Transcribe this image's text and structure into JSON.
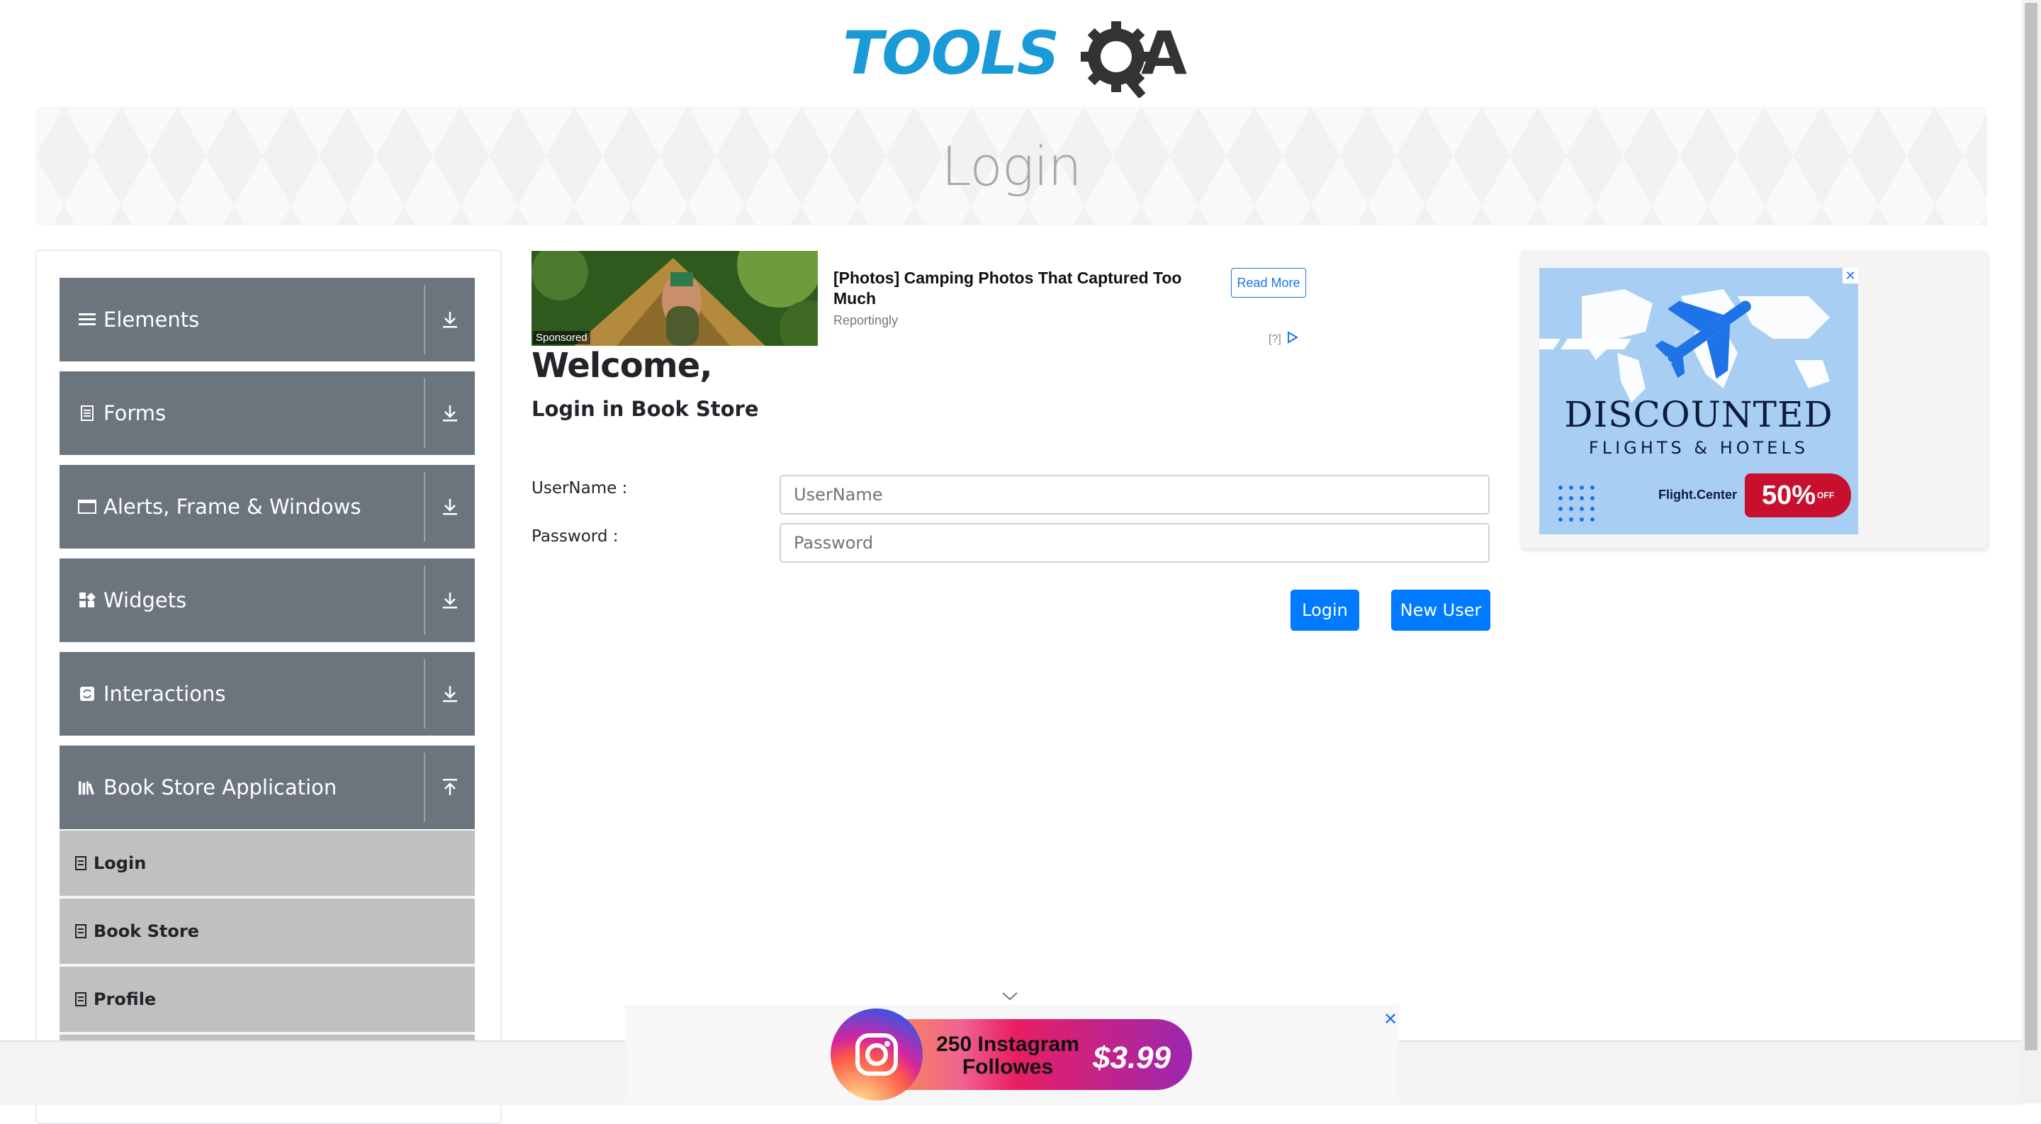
{
  "header": {
    "logo_text": "TOOLSQA"
  },
  "banner": {
    "title": "Login"
  },
  "sidebar": {
    "groups": [
      {
        "label": "Elements",
        "icon": "list-icon"
      },
      {
        "label": "Forms",
        "icon": "form-icon"
      },
      {
        "label": "Alerts, Frame & Windows",
        "icon": "window-icon"
      },
      {
        "label": "Widgets",
        "icon": "widgets-icon"
      },
      {
        "label": "Interactions",
        "icon": "interactions-icon"
      },
      {
        "label": "Book Store Application",
        "icon": "books-icon"
      }
    ],
    "subitems": [
      {
        "label": "Login"
      },
      {
        "label": "Book Store"
      },
      {
        "label": "Profile"
      }
    ]
  },
  "ad_top": {
    "sponsored": "Sponsored",
    "title": "[Photos] Camping Photos That Captured Too Much",
    "source": "Reportingly",
    "button": "Read More",
    "choices": "[?]"
  },
  "main": {
    "welcome": "Welcome,",
    "subtitle": "Login in Book Store",
    "username_label": "UserName :",
    "username_placeholder": "UserName",
    "password_label": "Password :",
    "password_placeholder": "Password",
    "login_button": "Login",
    "new_user_button": "New User"
  },
  "ad_right": {
    "title": "DISCOUNTED",
    "subtitle": "FLIGHTS & HOTELS",
    "brand": "Flight.Center",
    "discount": "50%",
    "discount_small": "OFF"
  },
  "ad_bottom": {
    "text": "250 Instagram Followes",
    "price": "$3.99"
  },
  "colors": {
    "primary": "#007bff",
    "sidebar_group": "#6c757d",
    "sidebar_sub": "#c0c0c0",
    "logo_blue": "#1a9bd7",
    "logo_dark": "#333333"
  }
}
